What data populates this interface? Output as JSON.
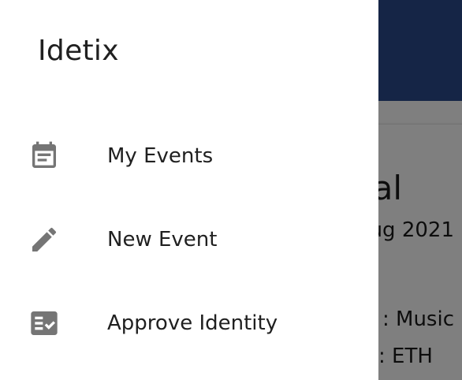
{
  "drawer": {
    "title": "Idetix",
    "items": [
      {
        "label": "My Events",
        "icon": "event-note-icon"
      },
      {
        "label": "New Event",
        "icon": "pencil-icon"
      },
      {
        "label": "Approve Identity",
        "icon": "checklist-icon"
      }
    ]
  },
  "background": {
    "event_title_fragment": "al",
    "event_date_fragment": "ug 2021",
    "genre_fragment": ": Music",
    "currency_fragment": ": ETH"
  },
  "colors": {
    "appbar": "#2a4a8c",
    "icon": "#757575",
    "text": "#202020",
    "scrim": "rgba(0,0,0,0.5)"
  }
}
